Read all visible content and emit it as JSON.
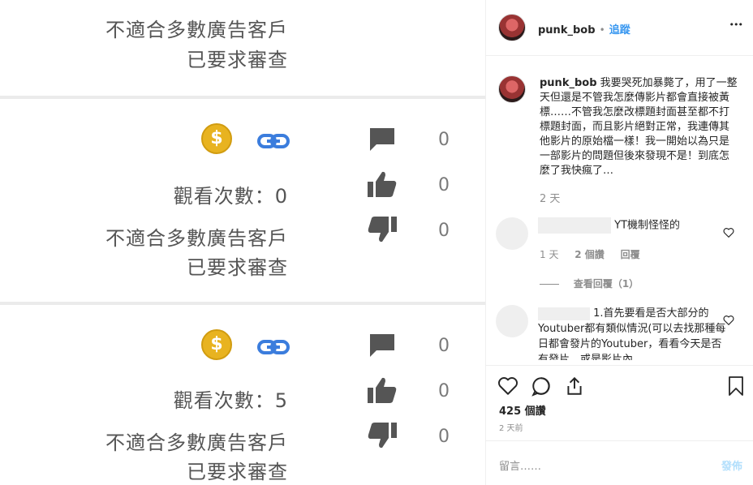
{
  "photo": {
    "block0": {
      "line1": "不適合多數廣告客戶",
      "line2": "已要求審查"
    },
    "block1": {
      "coin_symbol": "$",
      "views_label": "觀看次數：0",
      "counts": [
        "0",
        "0",
        "0"
      ],
      "line1": "不適合多數廣告客戶",
      "line2": "已要求審查"
    },
    "block2": {
      "coin_symbol": "$",
      "views_label": "觀看次數：5",
      "counts": [
        "0",
        "0",
        "0"
      ],
      "line1": "不適合多數廣告客戶",
      "line2": "已要求審查"
    }
  },
  "post": {
    "header": {
      "username": "punk_bob",
      "dot": "•",
      "follow": "追蹤",
      "more": "•••"
    },
    "caption": {
      "username": "punk_bob",
      "text": "我要哭死加暴斃了，用了一整天但還是不管我怎麼傳影片都會直接被黃標……不管我怎麼改標題封面甚至都不打標題封面，而且影片絕對正常，我連傳其他影片的原始檔一樣！我一開始以為只是一部影片的問題但後來發現不是！到底怎麼了我快瘋了…",
      "time": "2 天"
    },
    "comments": [
      {
        "text": "YT機制怪怪的",
        "time": "1 天",
        "likes": "2 個讚",
        "reply": "回覆",
        "view_replies": "查看回覆（1）"
      },
      {
        "text": "1.首先要看是否大部分的Youtuber都有類似情況(可以去找那種每日都會發片的Youtuber，看看今天是否有發片，或是影片內"
      }
    ],
    "likes": "425 個讚",
    "date": "2 天前",
    "add_comment": {
      "placeholder": "留言……",
      "post_button": "發佈"
    }
  },
  "colors": {
    "link": "#3897f0",
    "coin": "#e8b320",
    "youtube_link_icon": "#3b7ddd",
    "icon_gray": "#555555"
  },
  "icons": [
    "coin-icon",
    "link-icon",
    "comment-bubble-icon",
    "thumbs-up-icon",
    "thumbs-down-icon",
    "heart-icon",
    "comment-icon",
    "share-icon",
    "bookmark-icon",
    "more-icon"
  ]
}
